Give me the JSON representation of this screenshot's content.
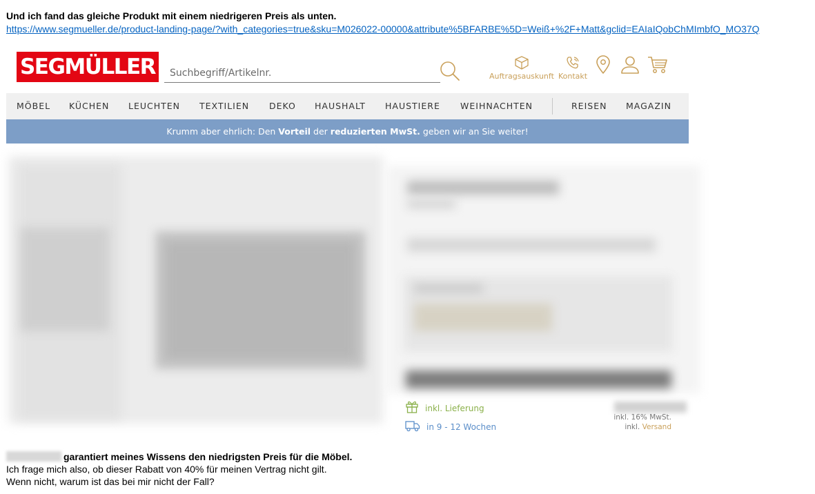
{
  "email": {
    "intro": "Und ich fand das gleiche Produkt mit einem niedrigeren Preis als unten.",
    "url": "https://www.segmueller.de/product-landing-page/?with_categories=true&sku=M026022-00000&attribute%5BFARBE%5D=Weiß+%2F+Matt&gclid=EAIaIQobChMImbfO_MO37Q",
    "closing_bold": "garantiert meines Wissens den niedrigsten Preis für die Möbel.",
    "closing_line1": "Ich frage mich also, ob dieser Rabatt von 40% für meinen Vertrag nicht gilt.",
    "closing_line2": "Wenn nicht, warum ist das bei mir nicht der Fall?"
  },
  "shop": {
    "logo_text": "SEGMÜLLER",
    "search_placeholder": "Suchbegriff/Artikelnr.",
    "header_icons": [
      {
        "icon": "box-icon",
        "label": "Auftragsauskunft"
      },
      {
        "icon": "phone-icon",
        "label": "Kontakt"
      },
      {
        "icon": "location-pin-icon"
      },
      {
        "icon": "user-icon"
      },
      {
        "icon": "cart-icon"
      }
    ],
    "nav": [
      "MÖBEL",
      "KÜCHEN",
      "LEUCHTEN",
      "TEXTILIEN",
      "DEKO",
      "HAUSHALT",
      "HAUSTIERE",
      "WEIHNACHTEN",
      "REISEN",
      "MAGAZIN"
    ],
    "banner": {
      "prefix": "Krumm aber ehrlich: Den ",
      "bold1": "Vorteil",
      "middle": " der ",
      "bold2": "reduzierten MwSt.",
      "suffix": " geben wir an Sie weiter!"
    },
    "delivery": {
      "icon": "gift-icon",
      "label": "inkl. Lieferung"
    },
    "shipping_time": {
      "icon": "truck-icon",
      "label": "in 9 - 12 Wochen"
    },
    "vat_note": "inkl. 16% MwSt.",
    "shipping_prefix": "inkl.",
    "shipping_link": "Versand"
  },
  "colors": {
    "brand_red": "#e30613",
    "gold": "#c9a05a",
    "banner_blue": "#7d9ec7",
    "nav_bg": "#f0f0f0",
    "link_blue": "#0563c1",
    "green": "#8ab04a"
  }
}
